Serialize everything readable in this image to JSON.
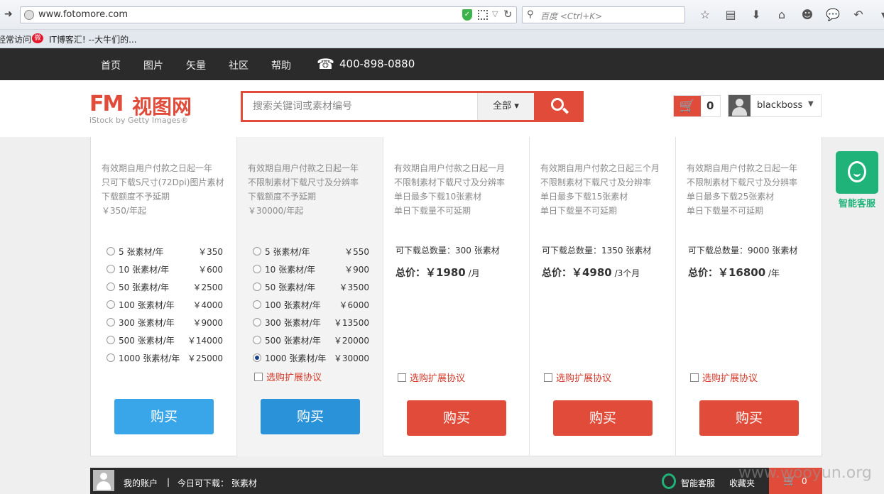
{
  "browser": {
    "url": "www.fotomore.com",
    "search_placeholder": "百度 <Ctrl+K>",
    "bookmarks": [
      "经常访问",
      "IT博客汇! --大牛们的..."
    ]
  },
  "topnav": {
    "items": [
      "首页",
      "图片",
      "矢量",
      "社区",
      "帮助"
    ],
    "phone": "400-898-0880"
  },
  "header": {
    "logo_mark": "FM",
    "logo_cn": "视图网",
    "logo_sub": "iStock by Getty Images®",
    "search_placeholder": "搜索关键词或素材编号",
    "search_category": "全部",
    "cart_count": "0",
    "username": "blackboss"
  },
  "plans": [
    {
      "desc": [
        "有效期自用户付款之日起一年",
        "只可下载S尺寸(72Dpi)图片素材",
        "下载额度不予延期",
        "￥350/年起"
      ],
      "options": [
        {
          "label": "5 张素材/年",
          "price": "￥350"
        },
        {
          "label": "10 张素材/年",
          "price": "￥600"
        },
        {
          "label": "50 张素材/年",
          "price": "￥2500"
        },
        {
          "label": "100 张素材/年",
          "price": "￥4000"
        },
        {
          "label": "300 张素材/年",
          "price": "￥9000"
        },
        {
          "label": "500 张素材/年",
          "price": "￥14000"
        },
        {
          "label": "1000 张素材/年",
          "price": "￥25000"
        }
      ],
      "buy": "购买"
    },
    {
      "desc": [
        "有效期自用户付款之日起一年",
        "不限制素材下载尺寸及分辨率",
        "下载额度不予延期",
        "￥30000/年起"
      ],
      "options": [
        {
          "label": "5 张素材/年",
          "price": "￥550"
        },
        {
          "label": "10 张素材/年",
          "price": "￥900"
        },
        {
          "label": "50 张素材/年",
          "price": "￥3500"
        },
        {
          "label": "100 张素材/年",
          "price": "￥6000"
        },
        {
          "label": "300 张素材/年",
          "price": "￥13500"
        },
        {
          "label": "500 张素材/年",
          "price": "￥20000"
        },
        {
          "label": "1000 张素材/年",
          "price": "￥30000"
        }
      ],
      "selected_option": "1000 张素材/年",
      "extension": "选购扩展协议",
      "buy": "购买"
    },
    {
      "desc": [
        "有效期自用户付款之日起一月",
        "不限制素材下载尺寸及分辨率",
        "单日最多下载10张素材",
        "单日下载量不可延期"
      ],
      "total_count": "可下载总数量：300 张素材",
      "total_label": "总价：",
      "total_price": "￥1980",
      "total_unit": "/月",
      "extension": "选购扩展协议",
      "buy": "购买"
    },
    {
      "desc": [
        "有效期自用户付款之日起三个月",
        "不限制素材下载尺寸及分辨率",
        "单日最多下载15张素材",
        "单日下载量不可延期"
      ],
      "total_count": "可下载总数量：1350 张素材",
      "total_label": "总价：",
      "total_price": "￥4980",
      "total_unit": "/3个月",
      "extension": "选购扩展协议",
      "buy": "购买"
    },
    {
      "desc": [
        "有效期自用户付款之日起一年",
        "不限制素材下载尺寸及分辨率",
        "单日最多下载25张素材",
        "单日下载量不可延期"
      ],
      "total_count": "可下载总数量：9000 张素材",
      "total_label": "总价：",
      "total_price": "￥16800",
      "total_unit": "/年",
      "extension": "选购扩展协议",
      "buy": "购买"
    }
  ],
  "service": {
    "label": "智能客服"
  },
  "bottombar": {
    "account": "我的账户",
    "sep": "|",
    "today": "今日可下载：  张素材",
    "service": "智能客服",
    "favorites": "收藏夹",
    "cart_count": "0"
  },
  "watermark": "www.wooyun.org"
}
